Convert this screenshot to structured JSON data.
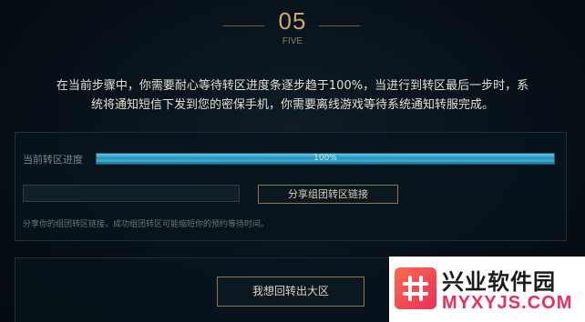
{
  "step": {
    "number": "05",
    "word": "FIVE"
  },
  "instructions": {
    "line1": "在当前步骤中，你需要耐心等待转区进度条逐步趋于100%，当进行到转区最后一步时，系",
    "line2": "统将通知短信下发到您的密保手机，你需要离线游戏等待系统通知转服完成。"
  },
  "progress": {
    "label": "当前转区进度",
    "percent_text": "100%",
    "fraction": 1.0
  },
  "share": {
    "link_value": "",
    "button_label": "分享组团转区链接",
    "hint": "分享你的组团转区链接，成功组团转区可能缩短你的预约等待时间。"
  },
  "actions": {
    "back_button_label": "我想回转出大区"
  },
  "watermark": {
    "title": "兴业软件园",
    "url": "MYXYJS.COM"
  },
  "colors": {
    "accent_gold": "#c8aa6e",
    "progress_blue": "#3ab0d8",
    "watermark_pink": "#e8305a"
  }
}
